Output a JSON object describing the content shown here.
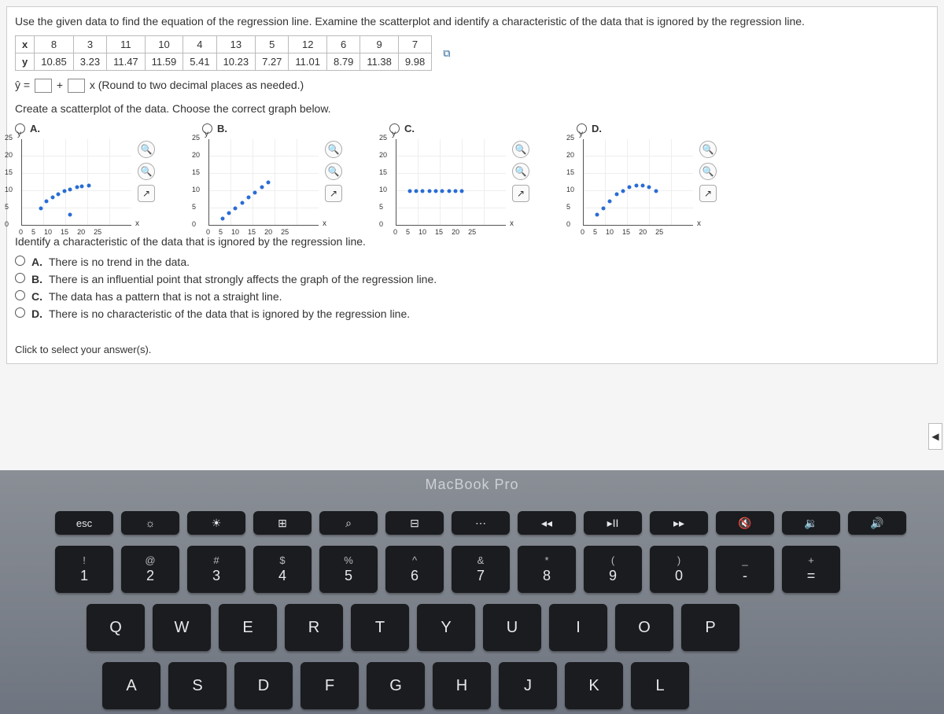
{
  "prompt": "Use the given data to find the equation of the regression line. Examine the scatterplot and identify a characteristic of the data that is ignored by the regression line.",
  "table": {
    "xlabel": "x",
    "ylabel": "y",
    "x": [
      "8",
      "3",
      "11",
      "10",
      "4",
      "13",
      "5",
      "12",
      "6",
      "9",
      "7"
    ],
    "y": [
      "10.85",
      "3.23",
      "11.47",
      "11.59",
      "5.41",
      "10.23",
      "7.27",
      "11.01",
      "8.79",
      "11.38",
      "9.98"
    ]
  },
  "equation": {
    "lhs": "ŷ =",
    "plus": "+",
    "xsym": "x",
    "note": "(Round to two decimal places as needed.)"
  },
  "scatter_prompt": "Create a scatterplot of the data. Choose the correct graph below.",
  "choices": [
    "A.",
    "B.",
    "C.",
    "D."
  ],
  "axis": {
    "y_ticks": [
      "25",
      "20",
      "15",
      "10",
      "5",
      "0"
    ],
    "x_ticks": [
      "0",
      "5",
      "10",
      "15",
      "20",
      "25"
    ],
    "ylab": "y",
    "xlab": "x"
  },
  "identify_prompt": "Identify a characteristic of the data that is ignored by the regression line.",
  "mc": {
    "A": "There is no trend in the data.",
    "B": "There is an influential point that strongly affects the graph of the regression line.",
    "C": "The data has a pattern that is not a straight line.",
    "D": "There is no characteristic of the data that is ignored by the regression line."
  },
  "mc_labels": {
    "A": "A.",
    "B": "B.",
    "C": "C.",
    "D": "D."
  },
  "footer": "Click to select your answer(s).",
  "laptop_label": "MacBook Pro",
  "fnrow": [
    "esc",
    "☼",
    "☀",
    "⊞",
    "⌕",
    "⊟",
    "⋯",
    "◂◂",
    "▸II",
    "▸▸",
    "🔇",
    "🔉",
    "🔊"
  ],
  "numrow_top": [
    "!",
    "@",
    "#",
    "$",
    "%",
    "^",
    "&",
    "*",
    "(",
    ")",
    "_",
    "+"
  ],
  "numrow_bot": [
    "1",
    "2",
    "3",
    "4",
    "5",
    "6",
    "7",
    "8",
    "9",
    "0",
    "-",
    "="
  ],
  "qwerty": [
    "Q",
    "W",
    "E",
    "R",
    "T",
    "Y",
    "U",
    "I",
    "O",
    "P"
  ],
  "asdf": [
    "A",
    "S",
    "D",
    "F",
    "G",
    "H",
    "J",
    "K",
    "L"
  ],
  "chart_data": {
    "type": "scatter",
    "title": "",
    "xlabel": "x",
    "ylabel": "y",
    "xlim": [
      0,
      25
    ],
    "ylim": [
      0,
      25
    ],
    "series": [
      {
        "name": "A",
        "x": [
          3,
          4,
          5,
          6,
          7,
          8,
          8,
          9,
          10,
          11
        ],
        "y": [
          5,
          7,
          8,
          9,
          10,
          3,
          10,
          11,
          11,
          11
        ]
      },
      {
        "name": "B",
        "x": [
          3,
          4,
          5,
          6,
          7,
          8,
          9,
          10,
          11,
          12,
          13
        ],
        "y": [
          2,
          3,
          4,
          5,
          6,
          7,
          8,
          9,
          10,
          11,
          12
        ]
      },
      {
        "name": "C",
        "x": [
          3,
          4,
          5,
          6,
          7,
          8,
          9,
          10,
          11,
          12,
          13
        ],
        "y": [
          10,
          10,
          10,
          10,
          10,
          10,
          10,
          10,
          10,
          10,
          10
        ]
      },
      {
        "name": "D",
        "x": [
          3,
          4,
          5,
          6,
          7,
          8,
          9,
          10,
          11,
          12,
          13
        ],
        "y": [
          3,
          5,
          7,
          9,
          10,
          11,
          11,
          12,
          11,
          10,
          10
        ]
      }
    ]
  }
}
